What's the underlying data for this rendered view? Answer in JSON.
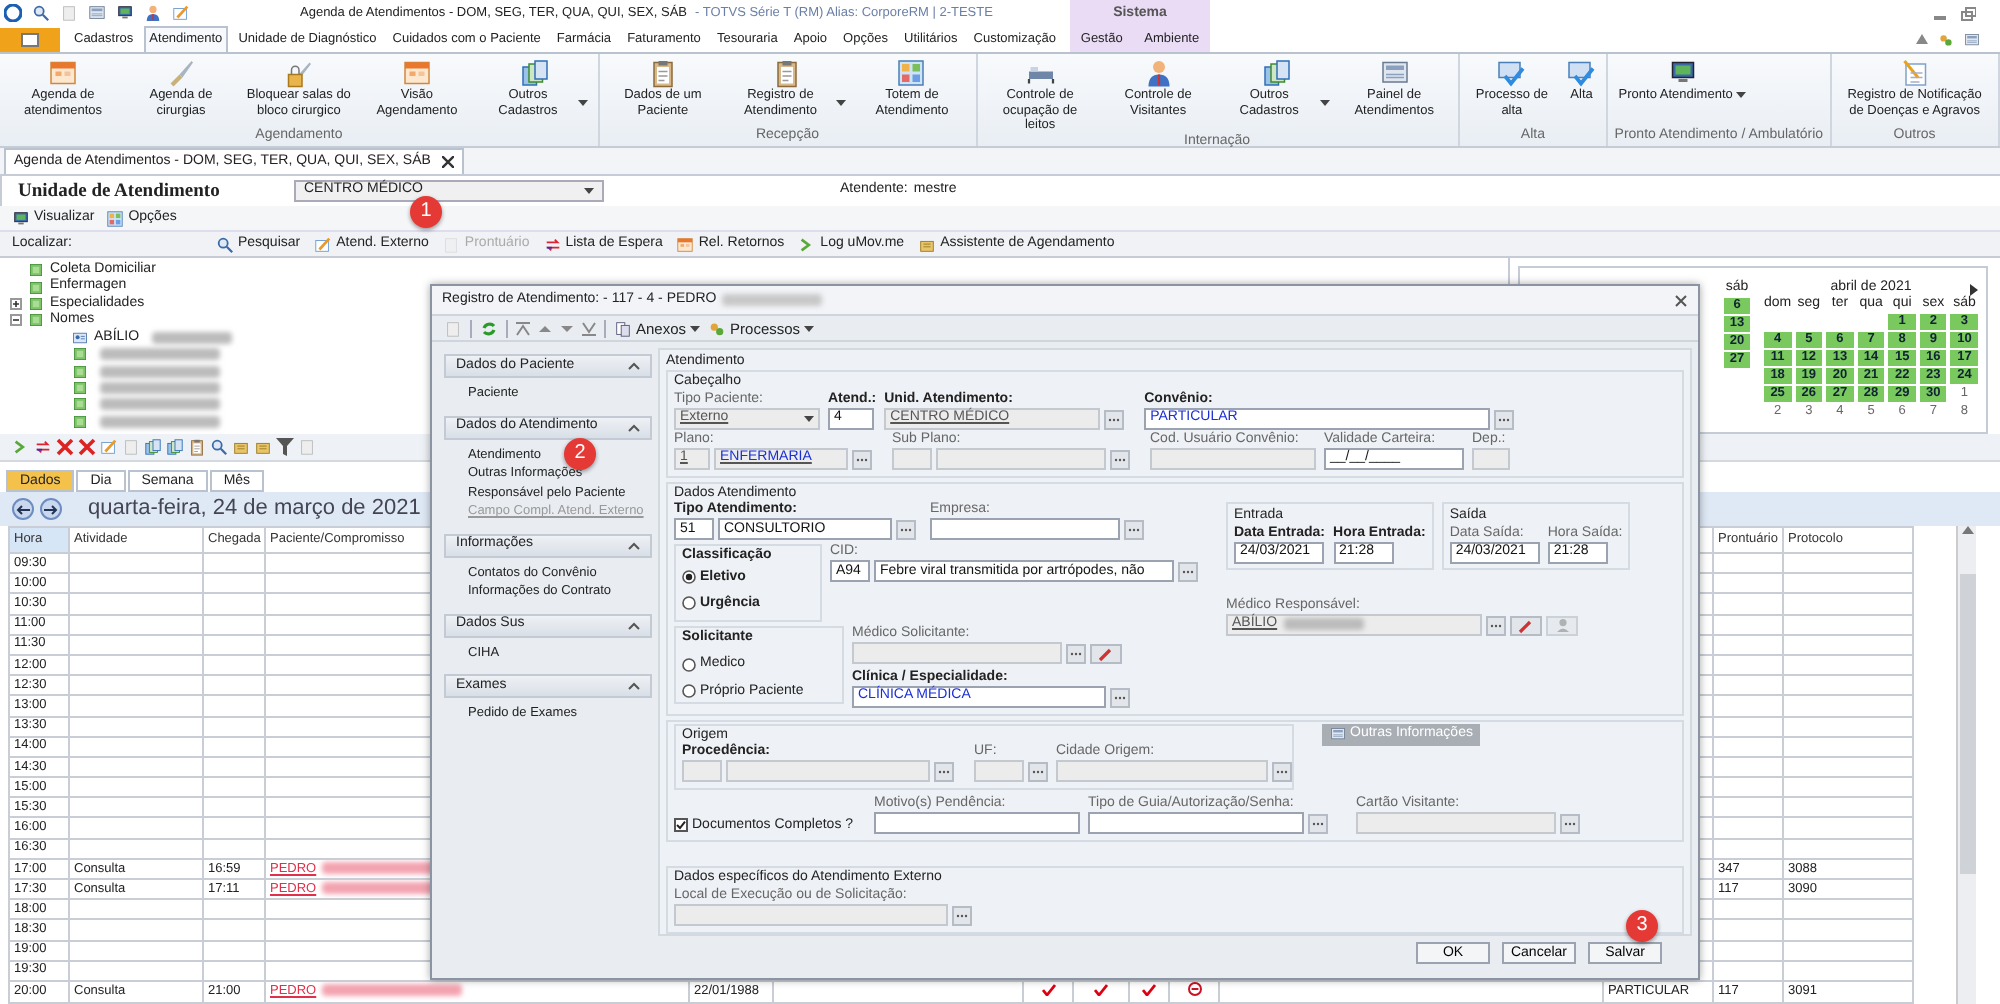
{
  "window": {
    "title": "Agenda de Atendimentos - DOM, SEG, TER, QUA, QUI, SEX, SÁB",
    "app_info": "- TOTVS Série T  (RM) Alias: CorporeRM | 2-TESTE",
    "context_label": "Sistema"
  },
  "ribbon": {
    "tabs": [
      {
        "label": "Cadastros",
        "selected": false,
        "context": false
      },
      {
        "label": "Atendimento",
        "selected": true,
        "context": false
      },
      {
        "label": "Unidade de Diagnóstico",
        "selected": false,
        "context": false
      },
      {
        "label": "Cuidados com o Paciente",
        "selected": false,
        "context": false
      },
      {
        "label": "Farmácia",
        "selected": false,
        "context": false
      },
      {
        "label": "Faturamento",
        "selected": false,
        "context": false
      },
      {
        "label": "Tesouraria",
        "selected": false,
        "context": false
      },
      {
        "label": "Apoio",
        "selected": false,
        "context": false
      },
      {
        "label": "Opções",
        "selected": false,
        "context": false
      },
      {
        "label": "Utilitários",
        "selected": false,
        "context": false
      },
      {
        "label": "Customização",
        "selected": false,
        "context": false
      },
      {
        "label": "Gestão",
        "selected": false,
        "context": true
      },
      {
        "label": "Ambiente",
        "selected": false,
        "context": true
      }
    ],
    "groups": [
      {
        "label": "Agendamento",
        "buttons": [
          {
            "label": "Agenda de atendimentos",
            "dropdown": false
          },
          {
            "label": "Agenda de cirurgias",
            "dropdown": false
          },
          {
            "label": "Bloquear salas do bloco cirurgico",
            "dropdown": false
          },
          {
            "label": "Visão Agendamento",
            "dropdown": false
          },
          {
            "label": "Outros Cadastros",
            "dropdown": true
          }
        ]
      },
      {
        "label": "Recepção",
        "buttons": [
          {
            "label": "Dados de um Paciente",
            "dropdown": false
          },
          {
            "label": "Registro de Atendimento",
            "dropdown": true
          },
          {
            "label": "Totem de Atendimento",
            "dropdown": false
          }
        ]
      },
      {
        "label": "Internação",
        "buttons": [
          {
            "label": "Controle de ocupação de leitos",
            "dropdown": false
          },
          {
            "label": "Controle de Visitantes",
            "dropdown": false
          },
          {
            "label": "Outros Cadastros",
            "dropdown": true
          },
          {
            "label": "Painel de Atendimentos",
            "dropdown": false
          }
        ]
      },
      {
        "label": "Alta",
        "buttons": [
          {
            "label": "Processo de alta",
            "dropdown": false
          },
          {
            "label": "Alta",
            "dropdown": false
          }
        ]
      },
      {
        "label": "Pronto Atendimento / Ambulatório",
        "buttons": [
          {
            "label": "Pronto Atendimento",
            "dropdown": true
          }
        ]
      },
      {
        "label": "Outros",
        "buttons": [
          {
            "label": "Registro de Notificação de Doenças e Agravos",
            "dropdown": false
          }
        ]
      }
    ]
  },
  "document_tab": {
    "label": "Agenda de Atendimentos - DOM, SEG, TER, QUA, QUI, SEX, SÁB"
  },
  "unit": {
    "label": "Unidade de Atendimento",
    "value": "CENTRO MÉDICO",
    "attendant_label": "Atendente:",
    "attendant": "mestre"
  },
  "toolbar": [
    {
      "label": "Visualizar"
    },
    {
      "label": "Opções"
    }
  ],
  "search_bar": {
    "label": "Localizar:",
    "actions": [
      {
        "label": "Pesquisar",
        "disabled": false
      },
      {
        "label": "Atend. Externo",
        "disabled": false
      },
      {
        "label": "Prontuário",
        "disabled": true
      },
      {
        "label": "Lista de Espera",
        "disabled": false
      },
      {
        "label": "Rel. Retornos",
        "disabled": false
      },
      {
        "label": "Log uMov.me",
        "disabled": false
      },
      {
        "label": "Assistente de Agendamento",
        "disabled": false
      }
    ]
  },
  "tree": [
    {
      "label": "Coleta Domiciliar"
    },
    {
      "label": "Enfermagen"
    },
    {
      "label": "Especialidades",
      "expanded": false
    },
    {
      "label": "Nomes",
      "expanded": true,
      "children": [
        {
          "label": "ABÍLIO",
          "kind": "person",
          "redacted": true
        },
        {
          "kind": "entry",
          "redacted": true
        },
        {
          "kind": "entry",
          "redacted": true
        },
        {
          "kind": "entry",
          "redacted": true
        },
        {
          "kind": "entry",
          "redacted": true
        },
        {
          "kind": "entry",
          "redacted": true
        }
      ]
    }
  ],
  "calendar": {
    "left_month": {
      "weekday": "sáb",
      "days": [
        {
          "label": "6",
          "booked": true
        },
        {
          "label": "13",
          "booked": true
        },
        {
          "label": "20",
          "booked": true
        },
        {
          "label": "27",
          "booked": true
        }
      ]
    },
    "right_month": {
      "title": "abril de 2021",
      "weekdays": [
        "dom",
        "seg",
        "ter",
        "qua",
        "qui",
        "sex",
        "sáb"
      ],
      "weeks": [
        [
          {
            "label": "1",
            "booked": true
          },
          {
            "label": "2",
            "booked": true
          },
          {
            "label": "3",
            "booked": true
          }
        ],
        [
          {
            "label": "4",
            "booked": true
          },
          {
            "label": "5",
            "booked": true
          },
          {
            "label": "6",
            "booked": true
          },
          {
            "label": "7",
            "booked": true
          },
          {
            "label": "8",
            "booked": true
          },
          {
            "label": "9",
            "booked": true
          },
          {
            "label": "10",
            "booked": true
          }
        ],
        [
          {
            "label": "11",
            "booked": true
          },
          {
            "label": "12",
            "booked": true
          },
          {
            "label": "13",
            "booked": true
          },
          {
            "label": "14",
            "booked": true
          },
          {
            "label": "15",
            "booked": true
          },
          {
            "label": "16",
            "booked": true
          },
          {
            "label": "17",
            "booked": true
          }
        ],
        [
          {
            "label": "18",
            "booked": true
          },
          {
            "label": "19",
            "booked": true
          },
          {
            "label": "20",
            "booked": true
          },
          {
            "label": "21",
            "booked": true
          },
          {
            "label": "22",
            "booked": true
          },
          {
            "label": "23",
            "booked": true
          },
          {
            "label": "24",
            "booked": true
          }
        ],
        [
          {
            "label": "25",
            "booked": true
          },
          {
            "label": "26",
            "booked": true
          },
          {
            "label": "27",
            "booked": true
          },
          {
            "label": "28",
            "booked": true
          },
          {
            "label": "29",
            "booked": true
          },
          {
            "label": "30",
            "booked": true
          },
          {
            "label": "1",
            "booked": false
          }
        ],
        [
          {
            "label": "2",
            "booked": false
          },
          {
            "label": "3",
            "booked": false
          },
          {
            "label": "4",
            "booked": false
          },
          {
            "label": "5",
            "booked": false
          },
          {
            "label": "6",
            "booked": false
          },
          {
            "label": "7",
            "booked": false
          },
          {
            "label": "8",
            "booked": false
          }
        ]
      ]
    }
  },
  "view_tabs": [
    {
      "label": "Dados",
      "selected": true
    },
    {
      "label": "Dia",
      "selected": false
    },
    {
      "label": "Semana",
      "selected": false
    },
    {
      "label": "Mês",
      "selected": false
    }
  ],
  "date_header": "quarta-feira, 24 de março de 2021",
  "grid": {
    "columns": {
      "hora": "Hora",
      "atividade": "Atividade",
      "chegada": "Chegada",
      "paciente": "Paciente/Compromisso",
      "prontuario": "Prontuário",
      "protocolo": "Protocolo"
    },
    "rows": [
      {
        "hora": "09:30"
      },
      {
        "hora": "10:00"
      },
      {
        "hora": "10:30"
      },
      {
        "hora": "11:00"
      },
      {
        "hora": "11:30"
      },
      {
        "hora": "12:00"
      },
      {
        "hora": "12:30"
      },
      {
        "hora": "13:00"
      },
      {
        "hora": "13:30"
      },
      {
        "hora": "14:00"
      },
      {
        "hora": "14:30"
      },
      {
        "hora": "15:00"
      },
      {
        "hora": "15:30"
      },
      {
        "hora": "16:00"
      },
      {
        "hora": "16:30"
      },
      {
        "hora": "17:00",
        "atividade": "Consulta",
        "chegada": "16:59",
        "paciente": "PEDRO",
        "paciente_redacted": true,
        "prontuario": "347",
        "protocolo": "3088"
      },
      {
        "hora": "17:30",
        "atividade": "Consulta",
        "chegada": "17:11",
        "paciente": "PEDRO",
        "paciente_redacted": true,
        "prontuario": "117",
        "protocolo": "3090"
      },
      {
        "hora": "18:00"
      },
      {
        "hora": "18:30"
      },
      {
        "hora": "19:00"
      },
      {
        "hora": "19:30"
      },
      {
        "hora": "20:00",
        "atividade": "Consulta",
        "chegada": "21:00",
        "paciente": "PEDRO",
        "paciente_redacted": true,
        "column_5": "22/01/1988",
        "flags": [
          true,
          true,
          true
        ],
        "alert": true,
        "convenio": "PARTICULAR",
        "prontuario": "117",
        "protocolo": "3091"
      }
    ]
  },
  "dialog": {
    "title": "Registro de Atendimento: - 117 - 4 - PEDRO",
    "title_redacted": true,
    "toolbar": [
      {
        "label": "Anexos",
        "dropdown": true
      },
      {
        "label": "Processos",
        "dropdown": true
      }
    ],
    "nav": [
      {
        "title": "Dados do Paciente",
        "expanded": true,
        "items": [
          {
            "label": "Paciente",
            "disabled": false
          }
        ]
      },
      {
        "title": "Dados do Atendimento",
        "expanded": true,
        "items": [
          {
            "label": "Atendimento",
            "disabled": false
          },
          {
            "label": "Outras Informações",
            "disabled": false
          },
          {
            "label": "Responsável pelo Paciente",
            "disabled": false
          },
          {
            "label": "Campo Compl. Atend. Externo",
            "disabled": true
          }
        ]
      },
      {
        "title": "Informações",
        "expanded": true,
        "items": [
          {
            "label": "Contatos do Convênio",
            "disabled": false
          },
          {
            "label": "Informações do Contrato",
            "disabled": false
          }
        ]
      },
      {
        "title": "Dados Sus",
        "expanded": true,
        "items": [
          {
            "label": "CIHA",
            "disabled": false
          }
        ]
      },
      {
        "title": "Exames",
        "expanded": true,
        "items": [
          {
            "label": "Pedido de Exames",
            "disabled": false
          }
        ]
      }
    ],
    "form": {
      "title": "Atendimento",
      "cabecalho": {
        "title": "Cabeçalho",
        "tipo_paciente": {
          "label": "Tipo Paciente:",
          "value": "Externo",
          "required": false,
          "disabled": true
        },
        "atend": {
          "label": "Atend.:",
          "value": "4",
          "required": true,
          "disabled": false
        },
        "unid": {
          "label": "Unid. Atendimento:",
          "value": "CENTRO MÉDICO",
          "required": true,
          "disabled": true
        },
        "convenio": {
          "label": "Convênio:",
          "value": "PARTICULAR",
          "required": true,
          "disabled": false
        },
        "plano": {
          "label": "Plano:",
          "code": "1",
          "value": "ENFERMARIA",
          "required": false,
          "disabled": true
        },
        "sub_plano": {
          "label": "Sub Plano:",
          "required": false,
          "disabled": true
        },
        "cod_usuario": {
          "label": "Cod. Usuário Convênio:",
          "required": false,
          "disabled": true
        },
        "validade": {
          "label": "Validade Carteira:",
          "value": "__/__/____",
          "required": false,
          "disabled": false
        },
        "dep": {
          "label": "Dep.:",
          "required": false,
          "disabled": true
        }
      },
      "dados": {
        "title": "Dados Atendimento",
        "tipo_atendimento": {
          "label": "Tipo Atendimento:",
          "code": "51",
          "value": "CONSULTORIO",
          "required": true,
          "disabled": false
        },
        "empresa": {
          "label": "Empresa:",
          "required": false,
          "disabled": false
        },
        "classificacao": {
          "title": "Classificação",
          "options": [
            {
              "label": "Eletivo",
              "selected": true
            },
            {
              "label": "Urgência",
              "selected": false
            }
          ]
        },
        "cid": {
          "label": "CID:",
          "code": "A94",
          "value": "Febre viral transmitida por artrópodes, não",
          "required": false,
          "disabled": false
        },
        "solicitante": {
          "title": "Solicitante",
          "options": [
            {
              "label": "Medico",
              "selected": false
            },
            {
              "label": "Próprio Paciente",
              "selected": false
            }
          ]
        },
        "medico_solicitante": {
          "label": "Médico Solicitante:",
          "required": false,
          "disabled": true
        },
        "clinica": {
          "label": "Clínica / Especialidade:",
          "value": "CLÍNICA MÉDICA",
          "required": true,
          "disabled": false
        },
        "entrada": {
          "title": "Entrada",
          "data": {
            "label": "Data Entrada:",
            "value": "24/03/2021",
            "required": true,
            "disabled": false
          },
          "hora": {
            "label": "Hora Entrada:",
            "value": "21:28",
            "required": true,
            "disabled": false
          }
        },
        "saida": {
          "title": "Saída",
          "data": {
            "label": "Data Saída:",
            "value": "24/03/2021",
            "required": false,
            "disabled": false
          },
          "hora": {
            "label": "Hora Saída:",
            "value": "21:28",
            "required": false,
            "disabled": false
          }
        },
        "medico_responsavel": {
          "label": "Médico Responsável:",
          "value": "ABÍLIO",
          "redacted": true,
          "required": false,
          "disabled": true
        }
      },
      "origem": {
        "title": "Origem",
        "procedencia": {
          "label": "Procedência:",
          "required": true,
          "disabled": true
        },
        "uf": {
          "label": "UF:",
          "required": false,
          "disabled": true
        },
        "cidade": {
          "label": "Cidade Origem:",
          "required": false,
          "disabled": true
        },
        "outras_informacoes": "Outras Informações"
      },
      "documentos": {
        "label": "Documentos Completos ?",
        "checked": true
      },
      "motivo": {
        "label": "Motivo(s) Pendência:",
        "required": false,
        "disabled": false
      },
      "tipo_guia": {
        "label": "Tipo de Guia/Autorização/Senha:",
        "required": false,
        "disabled": false
      },
      "cartao": {
        "label": "Cartão Visitante:",
        "required": false,
        "disabled": true
      },
      "externo": {
        "title": "Dados específicos do Atendimento Externo",
        "local": {
          "label": "Local de Execução ou de Solicitação:",
          "required": false,
          "disabled": true
        }
      }
    },
    "buttons": [
      {
        "label": "OK"
      },
      {
        "label": "Cancelar"
      },
      {
        "label": "Salvar"
      }
    ]
  },
  "steps": [
    {
      "label": "1"
    },
    {
      "label": "2"
    },
    {
      "label": "3"
    }
  ]
}
